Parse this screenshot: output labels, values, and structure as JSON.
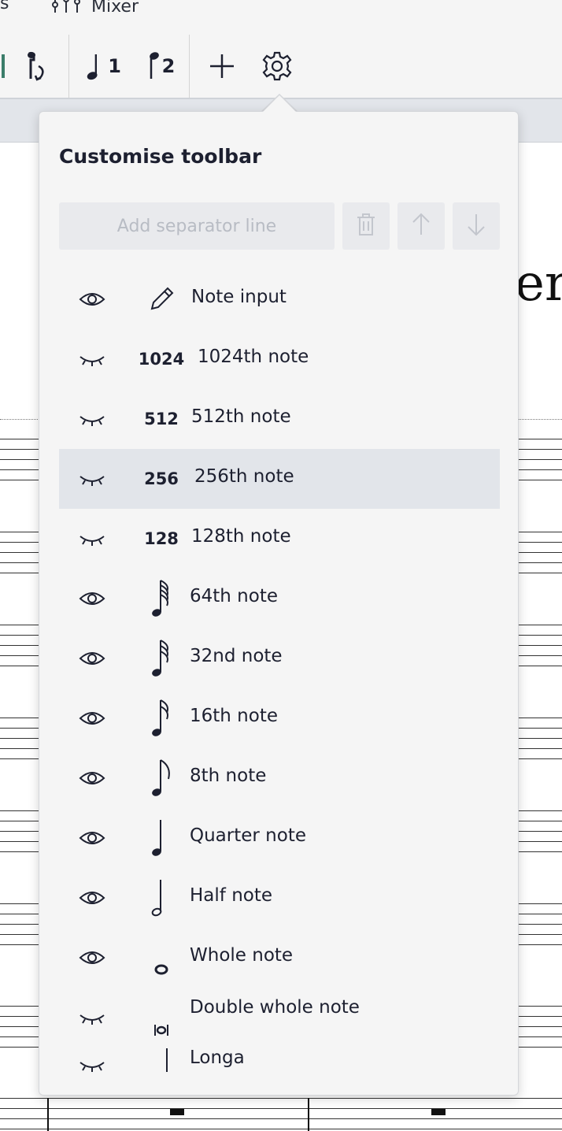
{
  "topbar": {
    "left_fragment": "s",
    "mixer_label": "Mixer"
  },
  "toolbar": {
    "buttons": [
      {
        "name": "flip-direction-icon"
      },
      {
        "name": "voice-1-icon",
        "label": "1"
      },
      {
        "name": "voice-2-icon",
        "label": "2"
      },
      {
        "name": "add-icon"
      },
      {
        "name": "gear-icon"
      }
    ]
  },
  "score": {
    "title_fragment": "er"
  },
  "popup": {
    "title": "Customise toolbar",
    "add_separator_label": "Add separator line",
    "items": [
      {
        "visible": true,
        "icon": "pencil-icon",
        "icon_text": "",
        "label": "Note input"
      },
      {
        "visible": false,
        "icon": "duration-1024-icon",
        "icon_text": "1024",
        "label": "1024th note"
      },
      {
        "visible": false,
        "icon": "duration-512-icon",
        "icon_text": "512",
        "label": "512th note"
      },
      {
        "visible": false,
        "icon": "duration-256-icon",
        "icon_text": "256",
        "label": "256th note",
        "selected": true
      },
      {
        "visible": false,
        "icon": "duration-128-icon",
        "icon_text": "128",
        "label": "128th note"
      },
      {
        "visible": true,
        "icon": "64th-note-icon",
        "icon_text": "",
        "label": "64th note"
      },
      {
        "visible": true,
        "icon": "32nd-note-icon",
        "icon_text": "",
        "label": "32nd note"
      },
      {
        "visible": true,
        "icon": "16th-note-icon",
        "icon_text": "",
        "label": "16th note"
      },
      {
        "visible": true,
        "icon": "8th-note-icon",
        "icon_text": "",
        "label": "8th note"
      },
      {
        "visible": true,
        "icon": "quarter-note-icon",
        "icon_text": "",
        "label": "Quarter note"
      },
      {
        "visible": true,
        "icon": "half-note-icon",
        "icon_text": "",
        "label": "Half note"
      },
      {
        "visible": true,
        "icon": "whole-note-icon",
        "icon_text": "",
        "label": "Whole note"
      },
      {
        "visible": false,
        "icon": "double-whole-note-icon",
        "icon_text": "",
        "label": "Double whole note"
      },
      {
        "visible": false,
        "icon": "longa-icon",
        "icon_text": "",
        "label": "Longa"
      }
    ]
  },
  "colors": {
    "accent": "#1d2030",
    "selected_row": "#e2e5ea",
    "popup_bg": "#f5f5f5"
  }
}
